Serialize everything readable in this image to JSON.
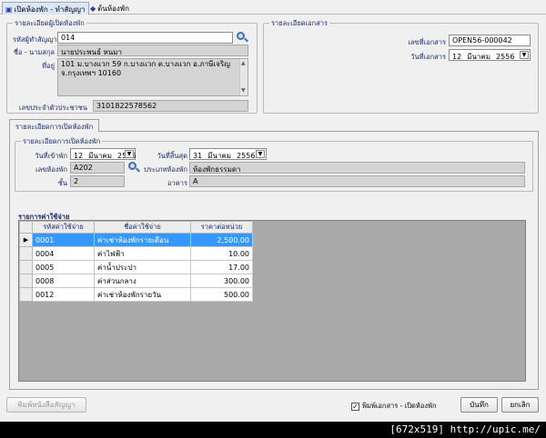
{
  "tabs": [
    {
      "label": "เปิดห้องพัก - ทำสัญญา"
    },
    {
      "label": "ต้นห้องพัก"
    }
  ],
  "tenant": {
    "legend": "รายละเอียดผู้เปิดห้องพัก",
    "code_label": "รหัสผู้ทำสัญญา",
    "code_value": "014",
    "name_label": "ชื่อ - นามสกุล",
    "name_value": "นายประพนธ์ หนมา",
    "address_label": "ที่อยู่",
    "address_value": "101 ม.บางแวก 59 ก.บางแวก ต.บางแวก อ.ภาษีเจริญ จ.กรุงเทพฯ 10160",
    "idcard_label": "เลขประจำตัวประชาชน",
    "idcard_value": "3101822578562"
  },
  "document": {
    "legend": "รายละเอียดเอกสาร",
    "docno_label": "เลขที่เอกสาร",
    "docno_value": "OPEN56-000042",
    "docdate_label": "วันที่เอกสาร",
    "docdate_day": "12",
    "docdate_month": "มีนาคม",
    "docdate_year": "2556"
  },
  "subtab_label": "รายละเอียดการเปิดห้องพัก",
  "room": {
    "legend": "รายละเอียดการเปิดห้องพัก",
    "checkin_label": "วันที่เข้าพัก",
    "checkin_day": "12",
    "checkin_month": "มีนาคม",
    "checkin_year": "2556",
    "end_label": "วันที่สิ้นสุด",
    "end_day": "31",
    "end_month": "มีนาคม",
    "end_year": "2556",
    "roomno_label": "เลขห้องพัก",
    "roomno_value": "A202",
    "roomtype_label": "ประเภทห้องพัก",
    "roomtype_value": "ห้องพักธรรมดา",
    "floor_label": "ชั้น",
    "floor_value": "2",
    "building_label": "อาคาร",
    "building_value": "A"
  },
  "expenses": {
    "title": "รายการค่าใช้จ่าย",
    "columns": [
      "รหัสค่าใช้จ่าย",
      "ชื่อค่าใช้จ่าย",
      "ราคาต่อหน่วย"
    ],
    "rows": [
      {
        "code": "0001",
        "name": "ค่าเช่าห้องพักรายเดือน",
        "price": "2,500.00"
      },
      {
        "code": "0004",
        "name": "ค่าไฟฟ้า",
        "price": "10.00"
      },
      {
        "code": "0005",
        "name": "ค่าน้ำประปา",
        "price": "17.00"
      },
      {
        "code": "0008",
        "name": "ค่าส่วนกลาง",
        "price": "300.00"
      },
      {
        "code": "0012",
        "name": "ค่าเช่าห้องพักรายวัน",
        "price": "500.00"
      }
    ],
    "selected_row": 0
  },
  "footer": {
    "print_contract_label": "พิมพ์หนังสือสัญญา",
    "print_doc_checkbox_label": "พิมพ์เอกสาร - เปิดห้องพัก",
    "print_doc_checked": true,
    "save_label": "บันทึก",
    "cancel_label": "ยกเลิก"
  },
  "watermark": "[672x519] http://upic.me/"
}
